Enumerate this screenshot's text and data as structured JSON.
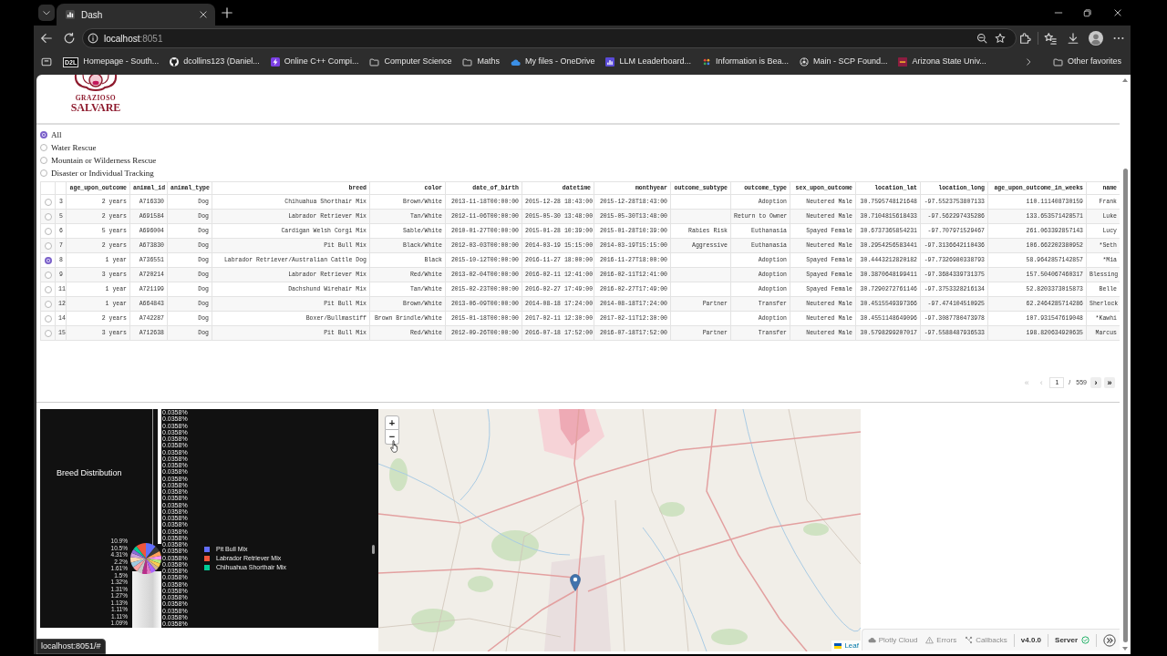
{
  "browser": {
    "tab": {
      "title": "Dash"
    },
    "address_bar": {
      "host": "localhost",
      "port": ":8051"
    },
    "bookmarks": [
      {
        "label": "Homepage - South...",
        "kind": "badge",
        "badge_text": "D2L"
      },
      {
        "label": "dcollins123 (Daniel...",
        "kind": "cat"
      },
      {
        "label": "Online C++ Compi...",
        "kind": "bolt"
      },
      {
        "label": "Computer Science",
        "kind": "folder"
      },
      {
        "label": "Maths",
        "kind": "folder"
      },
      {
        "label": "My files - OneDrive",
        "kind": "cloud"
      },
      {
        "label": "LLM Leaderboard...",
        "kind": "tile"
      },
      {
        "label": "Information is Bea...",
        "kind": "dots"
      },
      {
        "label": "Main - SCP Found...",
        "kind": "emblem"
      },
      {
        "label": "Arizona State Univ...",
        "kind": "crest"
      }
    ],
    "other_favorites": "Other favorites"
  },
  "logo": {
    "small_text": "GRAZIOSO",
    "large_text": "SALVARE"
  },
  "filter_options": [
    {
      "label": "All",
      "selected": true
    },
    {
      "label": "Water Rescue",
      "selected": false
    },
    {
      "label": "Mountain or Wilderness Rescue",
      "selected": false
    },
    {
      "label": "Disaster or Individual Tracking",
      "selected": false
    }
  ],
  "table": {
    "columns": [
      "age_upon_outcome",
      "animal_id",
      "animal_type",
      "breed",
      "color",
      "date_of_birth",
      "datetime",
      "monthyear",
      "outcome_subtype",
      "outcome_type",
      "sex_upon_outcome",
      "location_lat",
      "location_long",
      "age_upon_outcome_in_weeks",
      "name"
    ],
    "rows": [
      {
        "index": "3",
        "selected": false,
        "cells": [
          "2 years",
          "A716330",
          "Dog",
          "Chihuahua Shorthair Mix",
          "Brown/White",
          "2013-11-18T00:00:00",
          "2015-12-28 18:43:00",
          "2015-12-28T18:43:00",
          null,
          "Adoption",
          "Neutered Male",
          "30.7595748121648",
          "-97.5523753807133",
          "110.111408730159",
          "Frank"
        ]
      },
      {
        "index": "5",
        "selected": false,
        "cells": [
          "2 years",
          "A691584",
          "Dog",
          "Labrador Retriever Mix",
          "Tan/White",
          "2012-11-06T00:00:00",
          "2015-05-30 13:48:00",
          "2015-05-30T13:48:00",
          null,
          "Return to Owner",
          "Neutered Male",
          "30.7104815618433",
          "-97.562297435286",
          "133.653571428571",
          "Luke"
        ]
      },
      {
        "index": "6",
        "selected": false,
        "cells": [
          "5 years",
          "A696004",
          "Dog",
          "Cardigan Welsh Corgi Mix",
          "Sable/White",
          "2010-01-27T00:00:00",
          "2015-01-28 10:39:00",
          "2015-01-28T10:39:00",
          "Rabies Risk",
          "Euthanasia",
          "Spayed Female",
          "30.6737365854231",
          "-97.707971529467",
          "261.063392857143",
          "Lucy"
        ]
      },
      {
        "index": "7",
        "selected": false,
        "cells": [
          "2 years",
          "A673830",
          "Dog",
          "Pit Bull Mix",
          "Black/White",
          "2012-03-03T00:00:00",
          "2014-03-19 15:15:00",
          "2014-03-19T15:15:00",
          "Aggressive",
          "Euthanasia",
          "Neutered Male",
          "30.2954256583441",
          "-97.3136642110436",
          "106.662202380952",
          "*Seth"
        ]
      },
      {
        "index": "8",
        "selected": true,
        "cells": [
          "1 year",
          "A736551",
          "Dog",
          "Labrador Retriever/Australian Cattle Dog",
          "Black",
          "2015-10-12T00:00:00",
          "2016-11-27 18:00:00",
          "2016-11-27T18:00:00",
          null,
          "Adoption",
          "Spayed Female",
          "30.4443212820182",
          "-97.7326980338793",
          "58.9642857142857",
          "*Mia"
        ]
      },
      {
        "index": "9",
        "selected": false,
        "cells": [
          "3 years",
          "A720214",
          "Dog",
          "Labrador Retriever Mix",
          "Red/White",
          "2013-02-04T00:00:00",
          "2016-02-11 12:41:00",
          "2016-02-11T12:41:00",
          null,
          "Adoption",
          "Spayed Female",
          "30.3870648199411",
          "-97.3684339731375",
          "157.504067460317",
          "Blessing"
        ]
      },
      {
        "index": "11",
        "selected": false,
        "cells": [
          "1 year",
          "A721199",
          "Dog",
          "Dachshund Wirehair Mix",
          "Tan/White",
          "2015-02-23T00:00:00",
          "2016-02-27 17:49:00",
          "2016-02-27T17:49:00",
          null,
          "Adoption",
          "Spayed Female",
          "30.7290272761146",
          "-97.3753328216134",
          "52.8203373015873",
          "Belle"
        ]
      },
      {
        "index": "12",
        "selected": false,
        "cells": [
          "1 year",
          "A664843",
          "Dog",
          "Pit Bull Mix",
          "Brown/White",
          "2013-06-09T00:00:00",
          "2014-08-18 17:24:00",
          "2014-08-18T17:24:00",
          "Partner",
          "Transfer",
          "Neutered Male",
          "30.4515549397366",
          "-97.474104510925",
          "62.2464285714286",
          "Sherlock"
        ]
      },
      {
        "index": "14",
        "selected": false,
        "cells": [
          "2 years",
          "A742287",
          "Dog",
          "Boxer/Bullmastiff",
          "Brown Brindle/White",
          "2015-01-18T00:00:00",
          "2017-02-11 12:30:00",
          "2017-02-11T12:30:00",
          null,
          "Adoption",
          "Neutered Male",
          "30.4551148649096",
          "-97.3087780473978",
          "107.931547619048",
          "*Kawhi"
        ]
      },
      {
        "index": "15",
        "selected": false,
        "cells": [
          "3 years",
          "A712638",
          "Dog",
          "Pit Bull Mix",
          "Red/White",
          "2012-09-26T00:00:00",
          "2016-07-18 17:52:00",
          "2016-07-18T17:52:00",
          "Partner",
          "Transfer",
          "Neutered Male",
          "30.5798299207017",
          "-97.5588487936533",
          "198.820634920635",
          "Marcus"
        ]
      }
    ]
  },
  "pagination": {
    "first": {
      "symbol": "«",
      "disabled": true
    },
    "previous": {
      "symbol": "‹",
      "disabled": true
    },
    "current_page": "1",
    "separator": "/",
    "page_count": "559",
    "next": {
      "symbol": "›",
      "disabled": false
    },
    "last": {
      "symbol": "»",
      "disabled": false
    }
  },
  "chart": {
    "title": "Breed Distribution",
    "slice_labels": [
      "10.9%",
      "10.5%",
      "4.31%",
      "2.2%",
      "1.61%",
      "1.5%",
      "1.32%",
      "1.31%",
      "1.27%",
      "1.13%",
      "1.11%",
      "1.11%",
      "1.09%"
    ],
    "stacked_labels": [
      "0.0358%",
      "0.0358%",
      "0.0358%",
      "0.0358%",
      "0.0358%",
      "0.0358%",
      "0.0358%",
      "0.0358%",
      "0.0358%",
      "0.0358%",
      "0.0358%",
      "0.0358%",
      "0.0358%",
      "0.0358%",
      "0.0358%",
      "0.0358%",
      "0.0358%",
      "0.0358%",
      "0.0358%",
      "0.0358%",
      "0.0358%",
      "0.0358%",
      "0.0358%",
      "0.0358%",
      "0.0358%",
      "0.0358%",
      "0.0358%",
      "0.0358%",
      "0.0358%",
      "0.0358%",
      "0.0358%",
      "0.0358%",
      "0.0358%"
    ],
    "legend": [
      {
        "label": "Pit Bull Mix",
        "color": "#636efa"
      },
      {
        "label": "Labrador Retriever Mix",
        "color": "#ef553b"
      },
      {
        "label": "Chihuahua Shorthair Mix",
        "color": "#00cc96"
      }
    ]
  },
  "map": {
    "zoom_in": "+",
    "zoom_out": "−",
    "attribution": "Leaf"
  },
  "dev_tools": {
    "buttons": [
      {
        "label": "Plotly Cloud",
        "kind": "cloud"
      },
      {
        "label": "Errors",
        "kind": "errors"
      },
      {
        "label": "Callbacks",
        "kind": "callbacks"
      }
    ],
    "version": "v4.0.0",
    "server": {
      "label": "Server",
      "connected": true
    }
  },
  "status_url": "localhost:8051/#"
}
